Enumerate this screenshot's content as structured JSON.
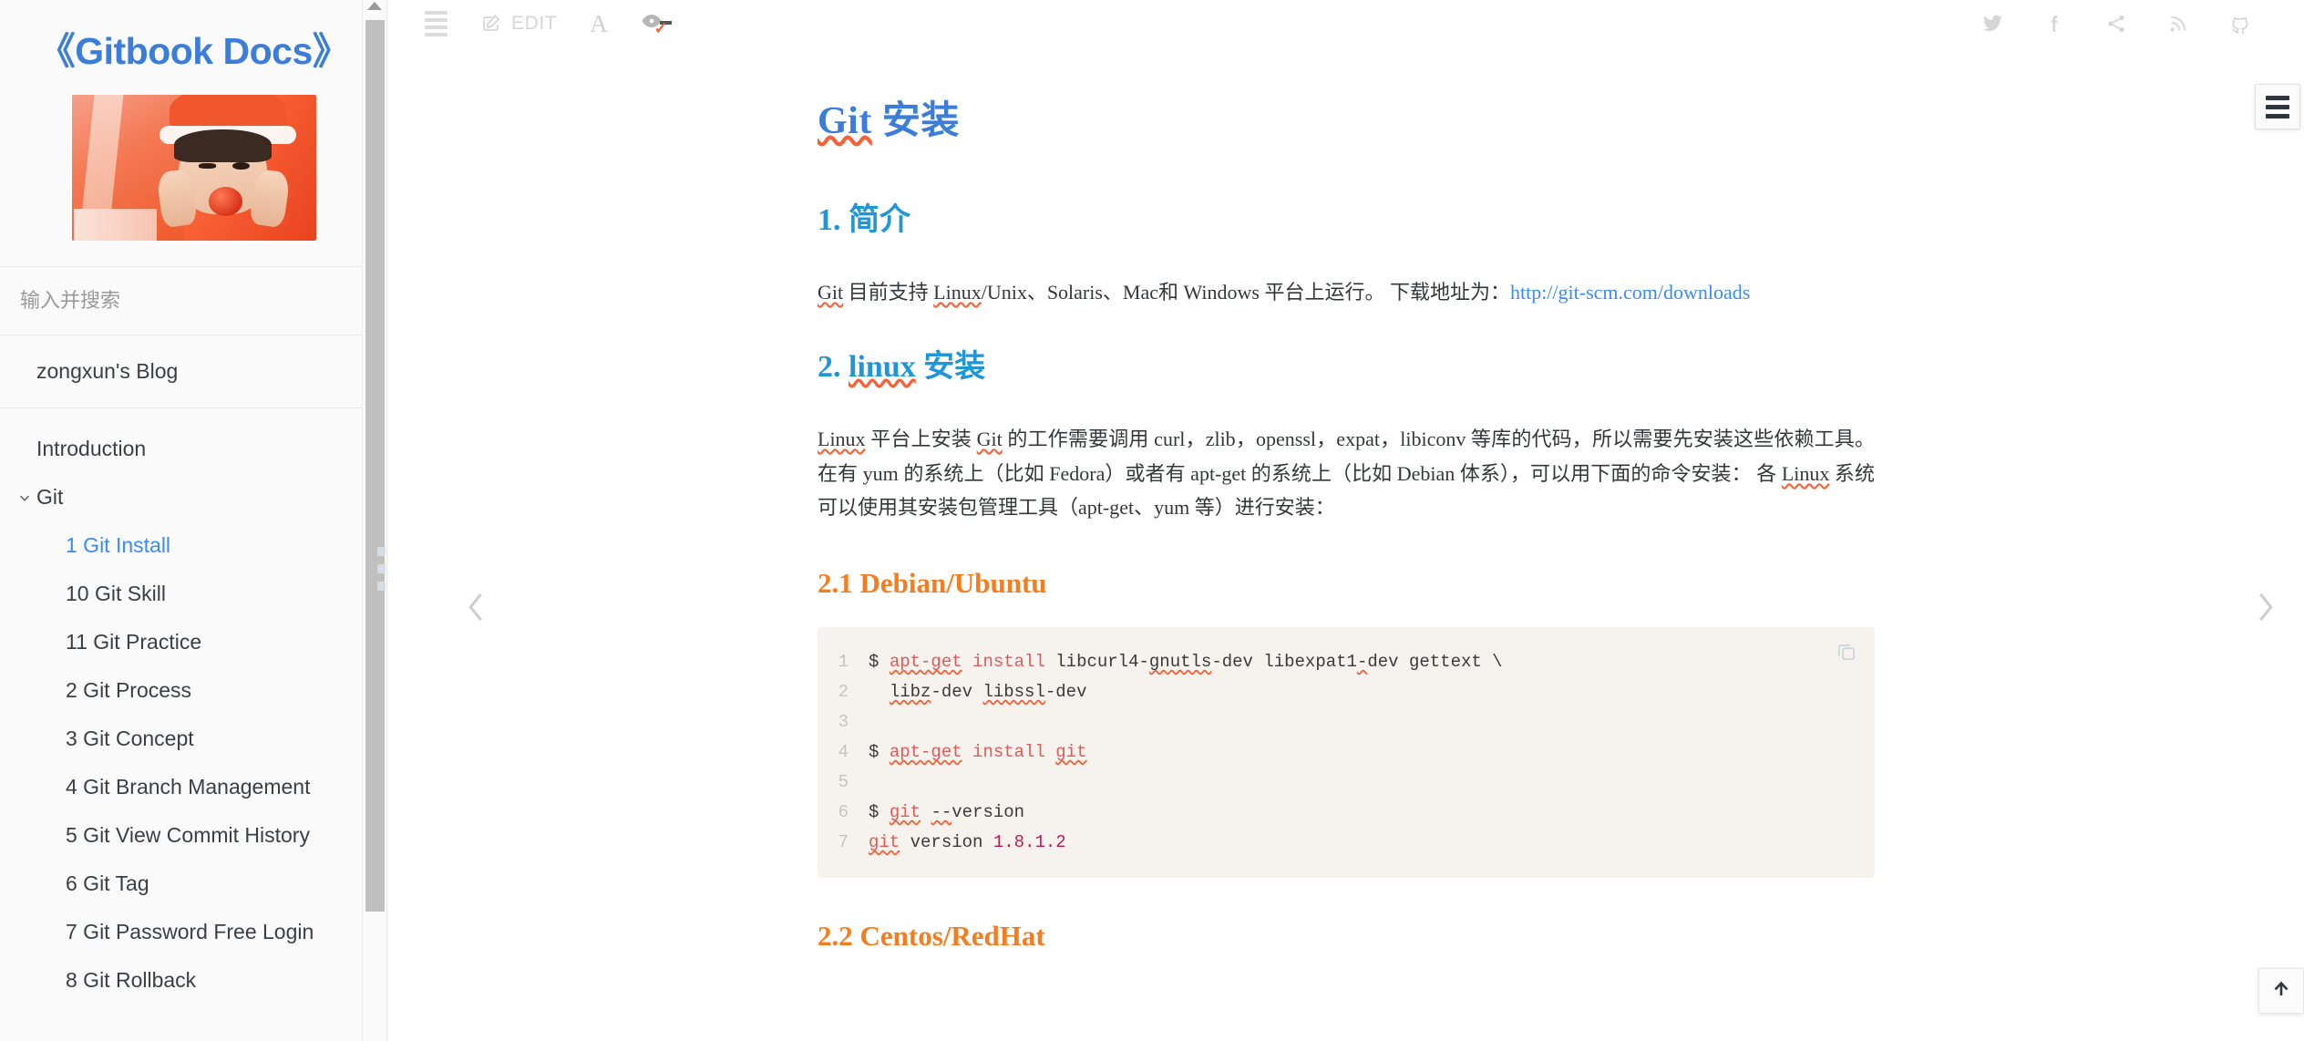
{
  "sidebar": {
    "book_title": "《Gitbook Docs》",
    "cover_alt": "book-cover-photo",
    "search": {
      "placeholder": "输入并搜索",
      "value": ""
    },
    "blog_title": "zongxun's Blog",
    "items": [
      {
        "label": "Introduction",
        "level": 1,
        "active": false,
        "caret": false
      },
      {
        "label": "Git",
        "level": 1,
        "active": false,
        "caret": true
      },
      {
        "label": "1 Git Install",
        "level": 2,
        "active": true,
        "caret": false
      },
      {
        "label": "10 Git Skill",
        "level": 2,
        "active": false,
        "caret": false
      },
      {
        "label": "11 Git Practice",
        "level": 2,
        "active": false,
        "caret": false
      },
      {
        "label": "2 Git Process",
        "level": 2,
        "active": false,
        "caret": false
      },
      {
        "label": "3 Git Concept",
        "level": 2,
        "active": false,
        "caret": false
      },
      {
        "label": "4 Git Branch Management",
        "level": 2,
        "active": false,
        "caret": false
      },
      {
        "label": "5 Git View Commit History",
        "level": 2,
        "active": false,
        "caret": false
      },
      {
        "label": "6 Git Tag",
        "level": 2,
        "active": false,
        "caret": false
      },
      {
        "label": "7 Git Password Free Login",
        "level": 2,
        "active": false,
        "caret": false
      },
      {
        "label": "8 Git Rollback",
        "level": 2,
        "active": false,
        "caret": false
      }
    ]
  },
  "toolbar": {
    "menu_icon": "hamburger-icon",
    "edit_label": "EDIT",
    "edit_icon": "pencil-square-icon",
    "font_label": "A",
    "font_icon": "font-size-icon",
    "preview_icon": "eye-icon",
    "social": [
      {
        "name": "twitter-icon",
        "label": "Twitter"
      },
      {
        "name": "facebook-icon",
        "label": "Facebook"
      },
      {
        "name": "share-icon",
        "label": "Share"
      },
      {
        "name": "rss-icon",
        "label": "RSS"
      },
      {
        "name": "github-icon",
        "label": "GitHub"
      }
    ]
  },
  "document": {
    "title_code": "Git",
    "title_rest": " 安装",
    "h2_1_num": "1. ",
    "h2_1_text": "简介",
    "p1_a": "Git",
    "p1_b": " 目前支持 ",
    "p1_c": "Linux",
    "p1_d": "/Unix、Solaris、Mac和 Windows 平台上运行。 下载地址为：",
    "p1_link": "http://git-scm.com/downloads",
    "h2_2_num": "2. ",
    "h2_2_code": "linux",
    "h2_2_text": " 安装",
    "p2_a": "Linux",
    "p2_b": " 平台上安装 ",
    "p2_c": "Git",
    "p2_d": " 的工作需要调用 curl，zlib，openssl，expat，libiconv 等库的代码，所以需要先安装这些依赖工具。在有 yum 的系统上（比如 Fedora）或者有 apt-get 的系统上（比如 Debian 体系），可以用下面的命令安装： 各 ",
    "p2_e": "Linux",
    "p2_f": " 系统可以使用其安装包管理工具（apt-get、yum 等）进行安装：",
    "h3_1": "2.1 Debian/Ubuntu",
    "h3_2": "2.2 Centos/RedHat",
    "code_copy_icon": "copy-icon",
    "code_lines": [
      {
        "n": "1",
        "text": "$ apt-get install libcurl4-gnutls-dev libexpat1-dev gettext \\"
      },
      {
        "n": "2",
        "text": "  libz-dev libssl-dev"
      },
      {
        "n": "3",
        "text": ""
      },
      {
        "n": "4",
        "text": "$ apt-get install git"
      },
      {
        "n": "5",
        "text": ""
      },
      {
        "n": "6",
        "text": "$ git --version"
      },
      {
        "n": "7",
        "text": "git version 1.8.1.2"
      }
    ]
  },
  "controls": {
    "prev_icon": "chevron-left-icon",
    "next_icon": "chevron-right-icon",
    "panel_toggle_icon": "hamburger-icon",
    "back_to_top_icon": "arrow-up-icon"
  },
  "colors": {
    "brand_blue": "#3b7dd8",
    "heading_blue": "#2196d6",
    "accent_orange": "#f47d20",
    "link_blue": "#3b8bf5",
    "spellcheck_red": "#f4623a",
    "sidebar_bg": "#fafafa",
    "code_bg": "#f6f3ee"
  }
}
